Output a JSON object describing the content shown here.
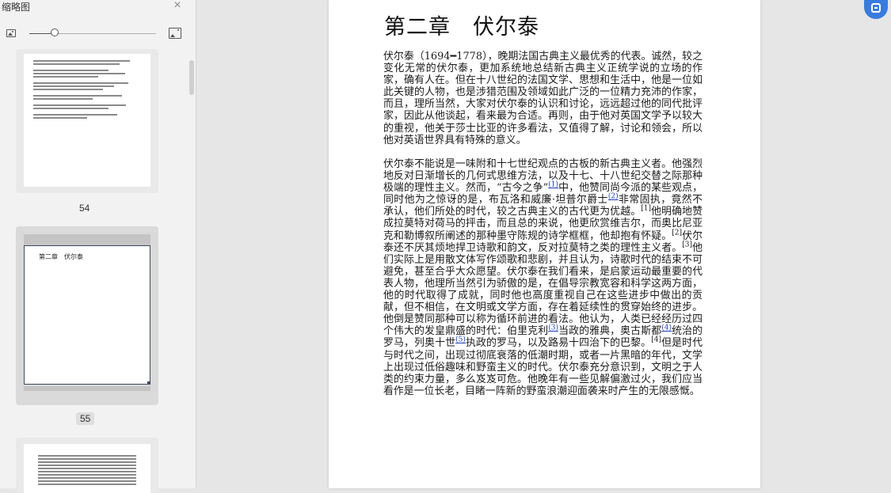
{
  "sidebar": {
    "title": "缩略图",
    "zoom_fraction": 0.2,
    "thumbnails": [
      {
        "label": "54",
        "active": false
      },
      {
        "label": "55",
        "active": true
      }
    ],
    "active_thumb_title": "第二章　伏尔泰"
  },
  "document": {
    "chapter_title": "第二章　伏尔泰",
    "p1": "伏尔泰（1694━1778），晚期法国古典主义最优秀的代表。诚然，较之变化无常的伏尔泰，更加系统地总结新古典主义正统学说的立场的作家，确有人在。但在十八世纪的法国文学、思想和生活中，他是一位如此关键的人物，也是涉猎范围及领域如此广泛的一位精力充沛的作家，而且，理所当然，大家对伏尔泰的认识和讨论，远远超过他的同代批评家，因此从他谈起，看来最为合适。再则，由于他对英国文学予以较大的重视，他关于莎士比亚的许多看法，又值得了解，讨论和领会，所以他对英语世界具有特殊的意义。",
    "p2": {
      "s1": "伏尔泰不能说是一味附和十七世纪观点的古板的新古典主义者。他强烈地反对日渐增长的几何式思维方法，以及十七、十八世纪交替之际那种极端的理性主义。然而，“古今之争”",
      "fn1": "(1)",
      "s2": "中，他赞同尚今派的某些观点，同时他为之惊讶的是，布瓦洛和威廉·坦普尔爵士",
      "fn2": "(2)",
      "s3": "非常固执，竟然不承认，他们所处的时代，较之古典主义的古代更为优越。",
      "r1": "[1]",
      "s4": "他明确地赞成拉莫特对荷马的抨击，而且总的来说，他更欣赏维吉尔，而奥比尼亚克和勒博叙所阐述的那种墨守陈规的诗学框框，他却抱有怀疑。",
      "r2": "[2]",
      "s5": "伏尔泰还不厌其烦地捍卫诗歌和韵文，反对拉莫特之类的理性主义者。",
      "r3": "[3]",
      "s6": "他们实际上是用散文体写作颂歌和悲剧，并且认为，诗歌时代的结束不可避免，甚至合乎大众愿望。伏尔泰在我们看来，是启蒙运动最重要的代表人物，他理所当然引为骄傲的是，在倡导宗教宽容和科学这两方面，他的时代取得了成就，同时他也高度重视自己在这些进步中做出的贡献，但不相信，在文明或文学方面，存在着延续性的贯穿始终的进步。他倒是赞同那种可以称为循环前进的看法。他认为，人类已经经历过四个伟大的发皇鼎盛的时代：伯里克利",
      "fn3": "(3)",
      "s7": "当政的雅典，奥古斯都",
      "fn4": "(4)",
      "s8": "统治的罗马，列奥十世",
      "fn5": "(5)",
      "s9": "执政的罗马，以及路易十四治下的巴黎。",
      "r4": "[4]",
      "s10": "但是时代与时代之间，出现过彻底衰落的低潮时期，或者一片黑暗的年代，文学上出现过低俗趣味和野蛮主义的时代。伏尔泰充分意识到，文明之于人类的约束力量，多么岌岌可危。他晚年有一些见解偏激过火，我们应当看作是一位长老，目睹一阵新的野蛮浪潮迎面袭来时产生的无限感慨。"
    }
  }
}
